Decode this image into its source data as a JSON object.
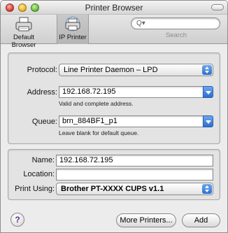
{
  "window": {
    "title": "Printer Browser"
  },
  "toolbar": {
    "default_browser_label": "Default Browser",
    "ip_printer_label": "IP Printer",
    "search_label": "Search",
    "search_value": ""
  },
  "connection": {
    "protocol_label": "Protocol:",
    "protocol_value": "Line Printer Daemon – LPD",
    "address_label": "Address:",
    "address_value": "192.168.72.195",
    "address_hint": "Valid and complete address.",
    "queue_label": "Queue:",
    "queue_value": "brn_884BF1_p1",
    "queue_hint": "Leave blank for default queue."
  },
  "printer": {
    "name_label": "Name:",
    "name_value": "192.168.72.195",
    "location_label": "Location:",
    "location_value": "",
    "print_using_label": "Print Using:",
    "print_using_value": "Brother PT-XXXX CUPS v1.1"
  },
  "footer": {
    "help_label": "?",
    "more_printers_label": "More Printers...",
    "add_label": "Add"
  },
  "colors": {
    "accent": "#2a6fd3",
    "window_bg": "#ececec"
  }
}
